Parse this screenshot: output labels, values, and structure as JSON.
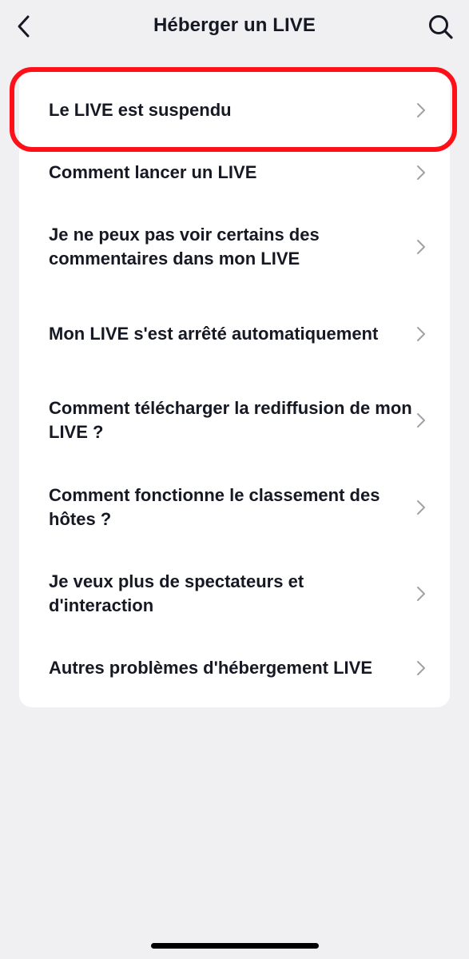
{
  "header": {
    "title": "Héberger un LIVE",
    "back_icon": "chevron-left-icon",
    "search_icon": "search-icon"
  },
  "items": [
    {
      "label": "Le LIVE est suspendu",
      "highlighted": true
    },
    {
      "label": "Comment lancer un LIVE"
    },
    {
      "label": "Je ne peux pas voir certains des commentaires dans mon LIVE"
    },
    {
      "label": "Mon LIVE s'est arrêté automatiquement"
    },
    {
      "label": "Comment télécharger la rediffusion de mon LIVE ?"
    },
    {
      "label": "Comment fonctionne le classement des hôtes ?"
    },
    {
      "label": "Je veux plus de spectateurs et d'interaction"
    },
    {
      "label": "Autres problèmes d'hébergement LIVE"
    }
  ],
  "colors": {
    "background": "#f0f0f3",
    "card": "#ffffff",
    "text": "#161823",
    "chevron": "#a0a0a6",
    "highlight": "#ff0f17"
  }
}
